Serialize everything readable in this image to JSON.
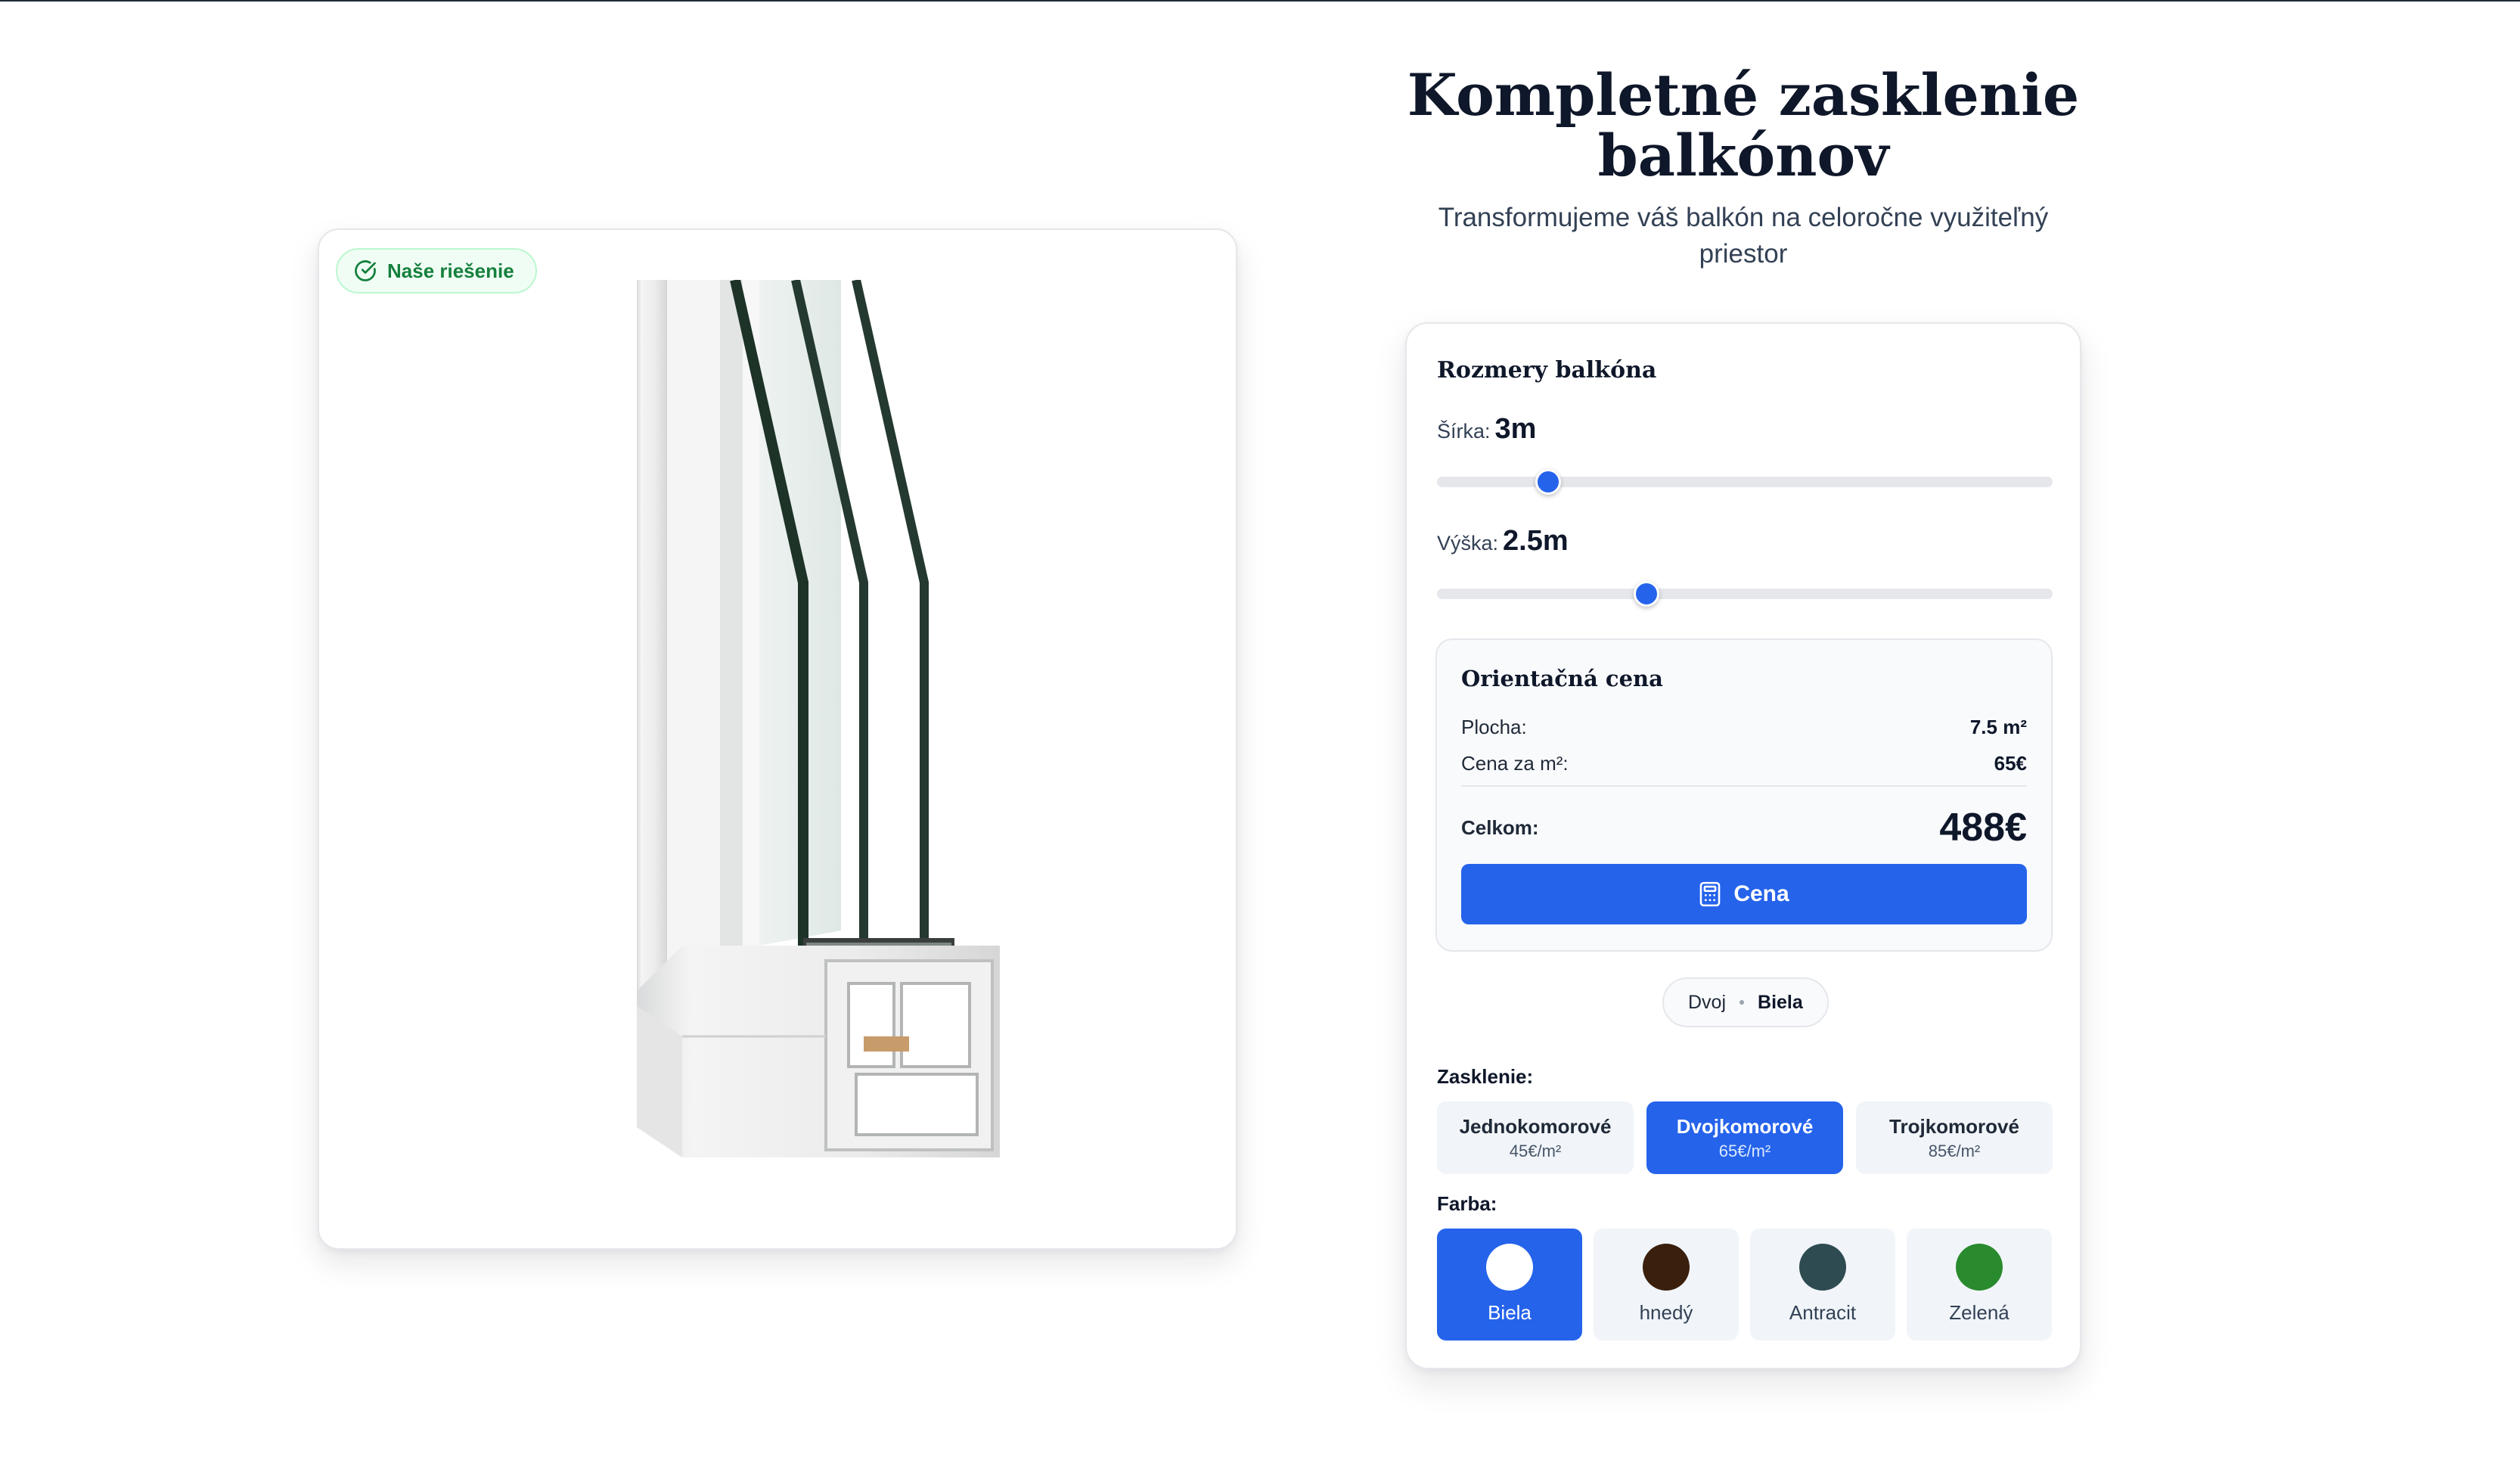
{
  "left_card": {
    "badge_label": "Naše riešenie",
    "badge_icon": "check-circle-icon",
    "image_subject": "window-profile-cross-section"
  },
  "hero": {
    "title": "Kompletné zasklenie balkónov",
    "subtitle": "Transformujeme váš balkón na celoročne využiteľný priestor"
  },
  "dimensions": {
    "section_title": "Rozmery balkóna",
    "width": {
      "label": "Šírka:",
      "value": "3m",
      "slider_fraction": 0.18
    },
    "height": {
      "label": "Výška:",
      "value": "2.5m",
      "slider_fraction": 0.34
    }
  },
  "price": {
    "title": "Orientačná cena",
    "area_label": "Plocha:",
    "area_value": "7.5 m²",
    "unit_price_label": "Cena za m²:",
    "unit_price_value": "65€",
    "total_label": "Celkom:",
    "total_value": "488€",
    "button_label": "Cena",
    "button_icon": "calculator-icon"
  },
  "summary": {
    "glazing": "Dvoj",
    "color": "Biela"
  },
  "glazing": {
    "label": "Zasklenie:",
    "options": [
      {
        "name": "Jednokomorové",
        "price": "45€/m²",
        "selected": false
      },
      {
        "name": "Dvojkomorové",
        "price": "65€/m²",
        "selected": true
      },
      {
        "name": "Trojkomorové",
        "price": "85€/m²",
        "selected": false
      }
    ]
  },
  "colors": {
    "label": "Farba:",
    "options": [
      {
        "name": "Biela",
        "hex": "#ffffff",
        "selected": true
      },
      {
        "name": "hnedý",
        "hex": "#3a1f0d",
        "selected": false
      },
      {
        "name": "Antracit",
        "hex": "#2f4b52",
        "selected": false
      },
      {
        "name": "Zelená",
        "hex": "#2a8a2e",
        "selected": false
      }
    ]
  },
  "theme": {
    "accent": "#2563eb",
    "success": "#15803d",
    "text": "#0f172a"
  }
}
